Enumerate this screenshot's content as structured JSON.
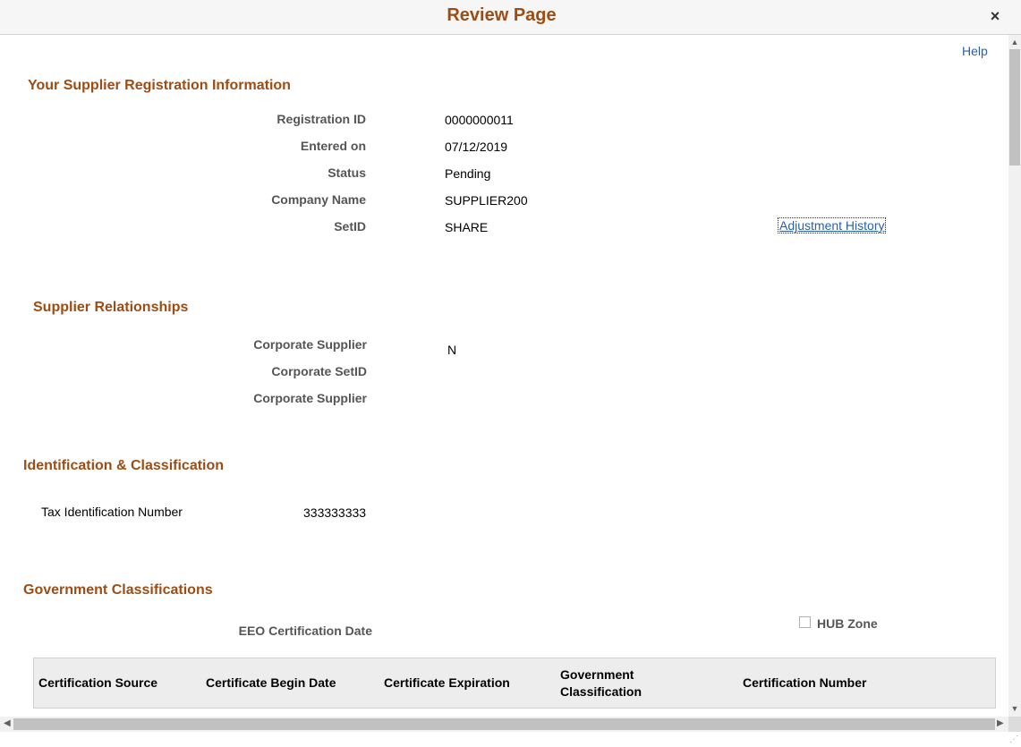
{
  "dialog": {
    "title": "Review Page",
    "close_label": "×",
    "help_label": "Help"
  },
  "registration": {
    "section_title": "Your Supplier Registration Information",
    "fields": [
      {
        "label": "Registration ID",
        "value": "0000000011"
      },
      {
        "label": "Entered on",
        "value": "07/12/2019"
      },
      {
        "label": "Status",
        "value": "Pending"
      },
      {
        "label": "Company Name",
        "value": "SUPPLIER200"
      },
      {
        "label": "SetID",
        "value": "SHARE"
      }
    ],
    "adjustment_history_link": "Adjustment History"
  },
  "relationships": {
    "section_title": "Supplier Relationships",
    "fields": [
      {
        "label": "Corporate Supplier",
        "value": "N"
      },
      {
        "label": "Corporate SetID",
        "value": ""
      },
      {
        "label": "Corporate Supplier",
        "value": ""
      }
    ]
  },
  "identification": {
    "section_title": "Identification & Classification",
    "tax_id_label": "Tax Identification Number",
    "tax_id_value": "333333333"
  },
  "government": {
    "section_title": "Government Classifications",
    "eeo_label": "EEO Certification Date",
    "hub_zone_label": "HUB Zone",
    "hub_zone_checked": false,
    "columns": [
      "Certification Source",
      "Certificate Begin Date",
      "Certificate Expiration",
      "Government Classification",
      "Certification Number"
    ]
  },
  "icons": {
    "close": "close-icon",
    "scroll_up": "arrow-up-icon",
    "scroll_down": "arrow-down-icon",
    "scroll_left": "arrow-left-icon",
    "scroll_right": "arrow-right-icon",
    "resize": "resize-grip-icon"
  },
  "colors": {
    "section_title": "#9d4d13",
    "link": "#2960b0",
    "label": "#555555"
  }
}
